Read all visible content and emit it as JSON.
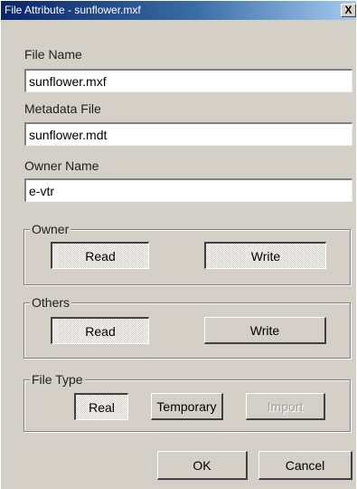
{
  "window": {
    "title": "File Attribute - sunflower.mxf",
    "close_glyph": "X"
  },
  "fields": {
    "file_name": {
      "label": "File Name",
      "value": "sunflower.mxf"
    },
    "metadata_file": {
      "label": "Metadata File",
      "value": "sunflower.mdt"
    },
    "owner_name": {
      "label": "Owner Name",
      "value": "e-vtr"
    }
  },
  "groups": {
    "owner": {
      "label": "Owner",
      "read": "Read",
      "write": "Write"
    },
    "others": {
      "label": "Others",
      "read": "Read",
      "write": "Write"
    },
    "file_type": {
      "label": "File Type",
      "real": "Real",
      "temporary": "Temporary",
      "import": "Import"
    }
  },
  "buttons": {
    "ok": "OK",
    "cancel": "Cancel"
  },
  "states": {
    "owner_read": "pressed",
    "owner_write": "pressed",
    "others_read": "pressed",
    "others_write": "raised",
    "real": "pressed",
    "temporary": "raised",
    "import": "disabled"
  },
  "colors": {
    "titlebar_start": "#0a246a",
    "titlebar_end": "#a6caf0",
    "face": "#d4d0c8",
    "disabled_text": "#a0a0a0"
  }
}
